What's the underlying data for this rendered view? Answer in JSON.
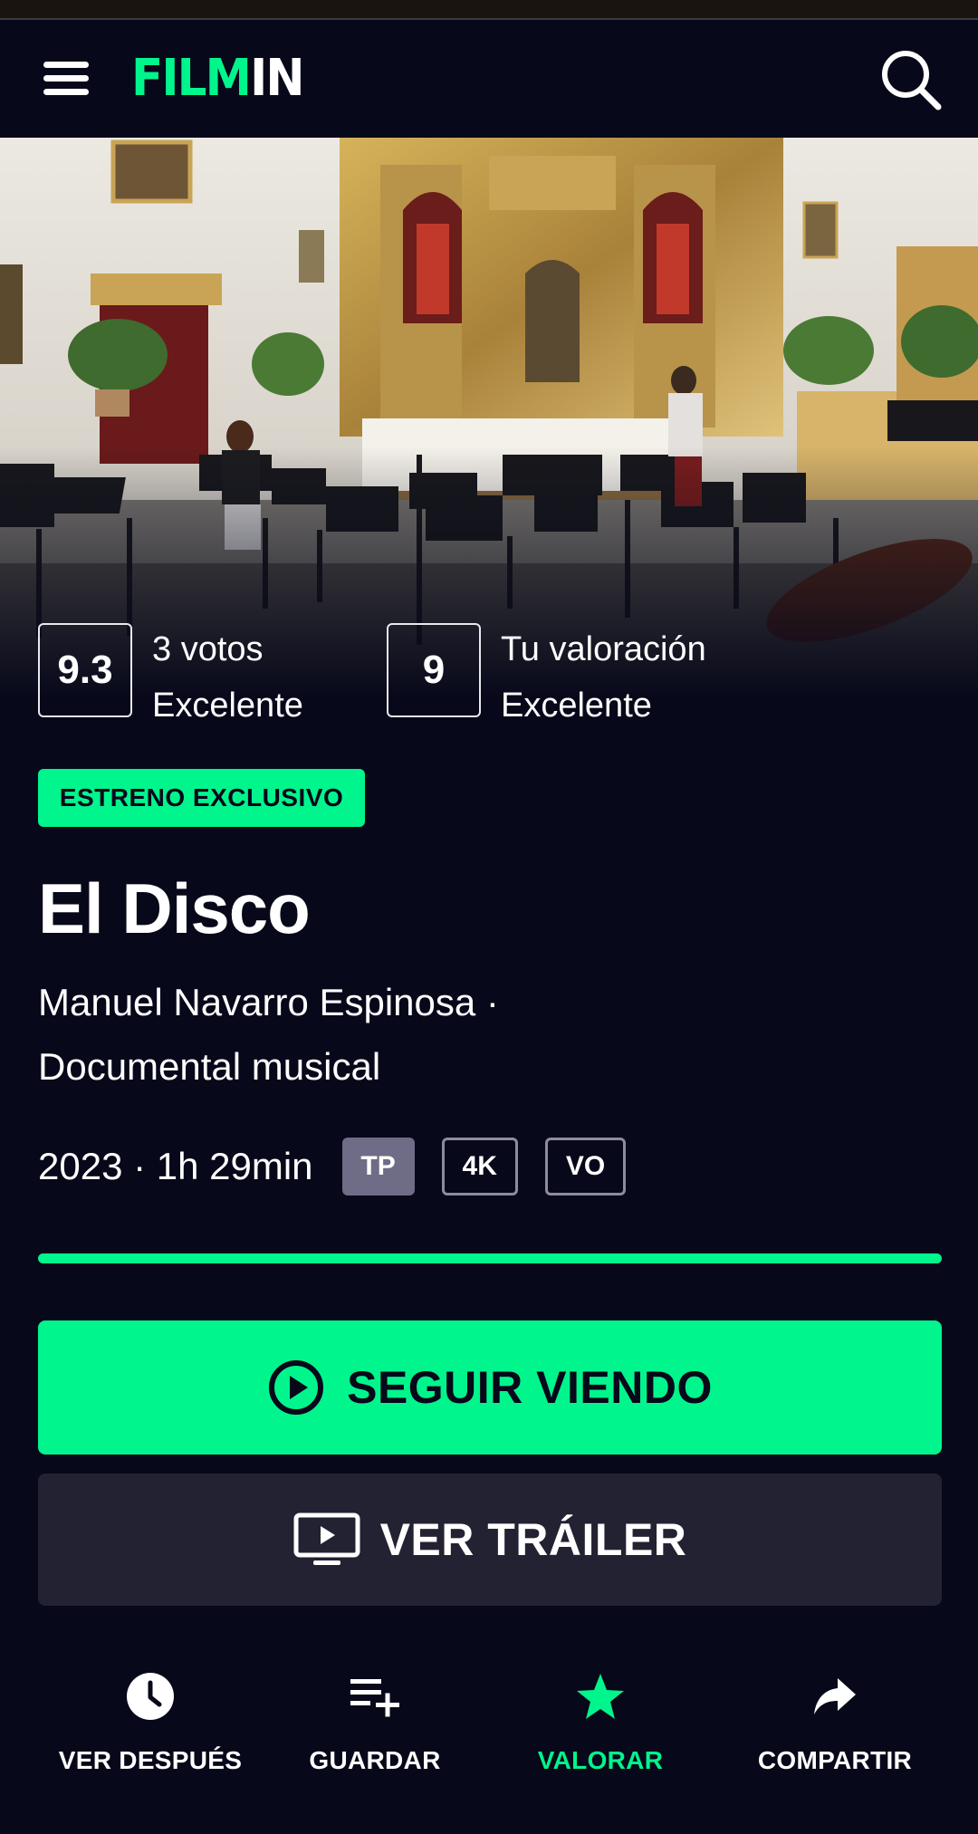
{
  "header": {
    "logo_part1": "FILM",
    "logo_part2": "IN",
    "menu_icon": "hamburger-menu-icon",
    "search_icon": "search-icon"
  },
  "ratings": {
    "average": {
      "score": "9.3",
      "line1": "3 votos",
      "line2": "Excelente"
    },
    "user": {
      "score": "9",
      "line1": "Tu valoración",
      "line2": "Excelente"
    }
  },
  "badge": "ESTRENO EXCLUSIVO",
  "movie": {
    "title": "El Disco",
    "meta_line1": "Manuel Navarro Espinosa ·",
    "meta_line2": "Documental musical",
    "year_duration": "2023 · 1h 29min",
    "tags": [
      "TP",
      "4K",
      "VO"
    ],
    "progress_fraction": 1.0
  },
  "buttons": {
    "primary": "SEGUIR VIENDO",
    "secondary": "VER TRÁILER"
  },
  "actions": [
    {
      "label": "VER DESPUÉS",
      "icon": "clock-icon",
      "active": false
    },
    {
      "label": "GUARDAR",
      "icon": "playlist-add-icon",
      "active": false
    },
    {
      "label": "VALORAR",
      "icon": "star-icon",
      "active": true
    },
    {
      "label": "COMPARTIR",
      "icon": "share-icon",
      "active": false
    }
  ],
  "colors": {
    "accent": "#00f58c",
    "background": "#07081a",
    "secondary_button": "#232232"
  }
}
